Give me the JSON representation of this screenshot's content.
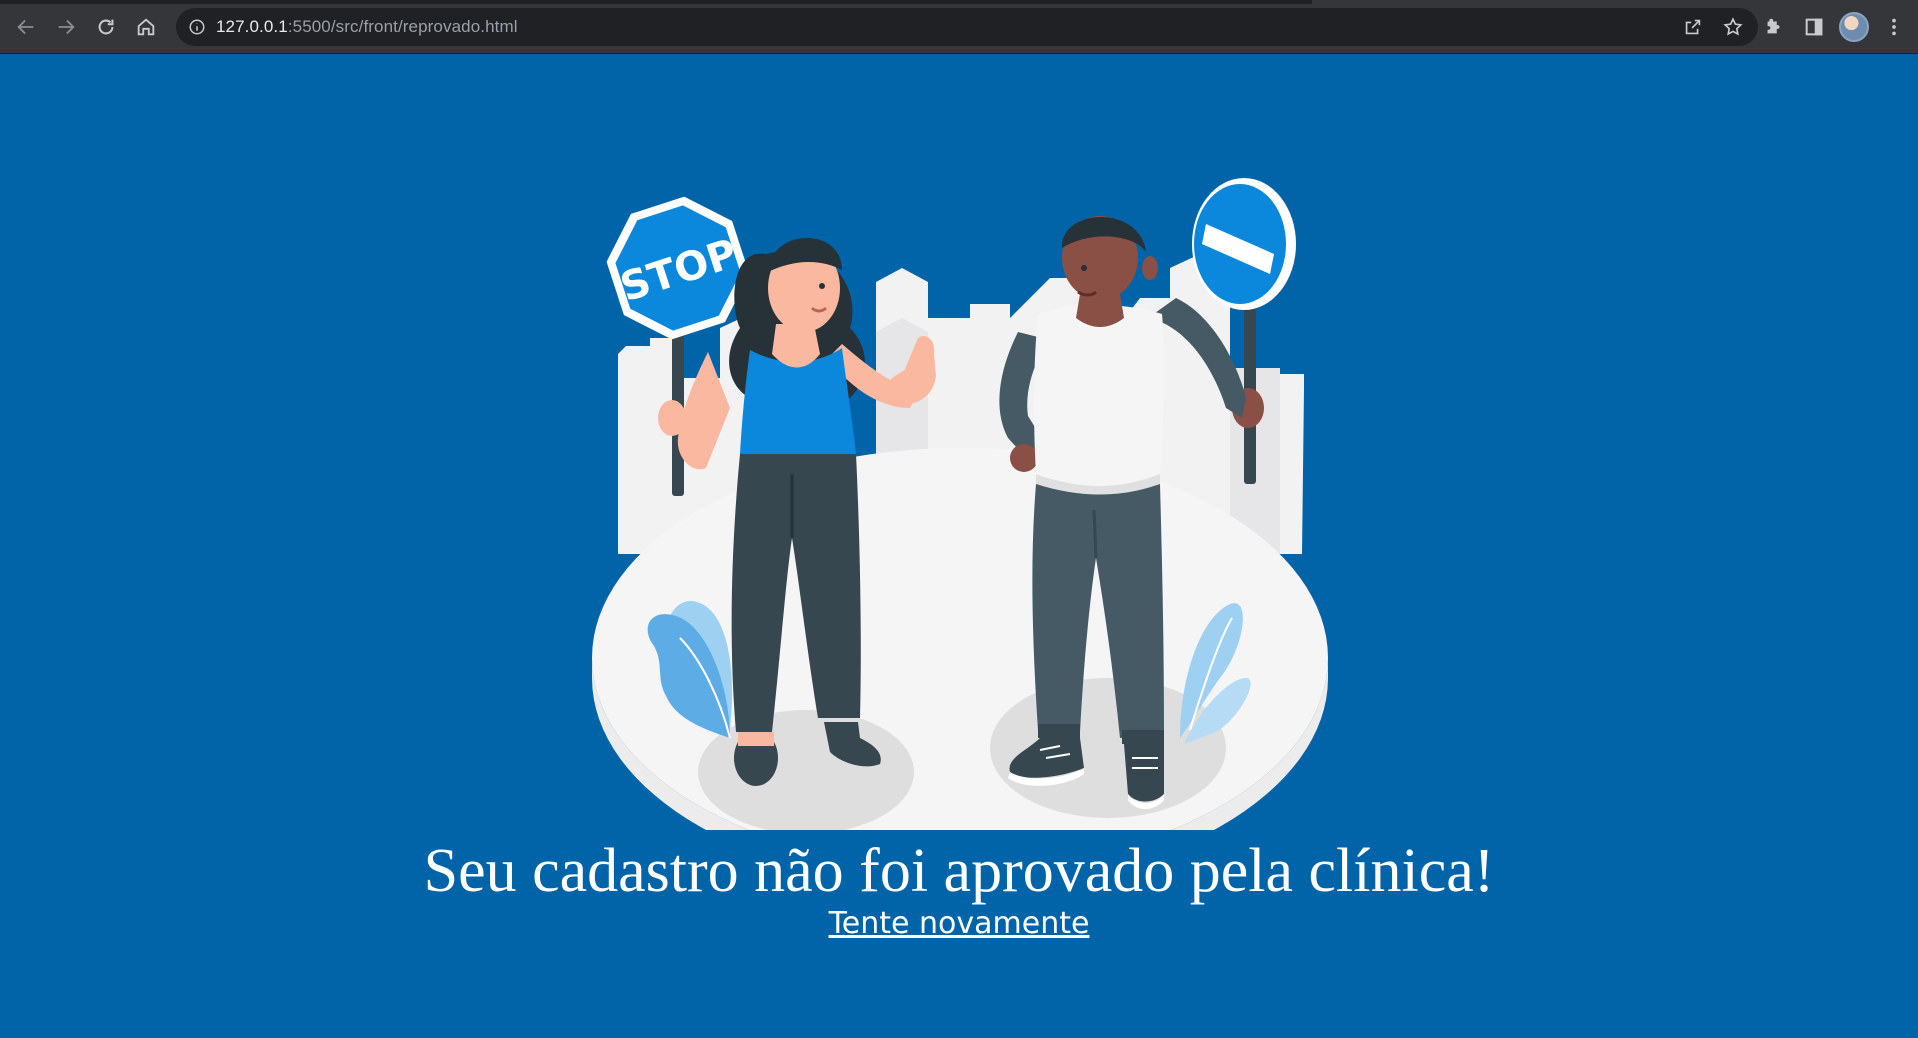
{
  "browser": {
    "url_host": "127.0.0.1",
    "url_rest": ":5500/src/front/reprovado.html"
  },
  "icons": {
    "back": "arrow-left-icon",
    "forward": "arrow-right-icon",
    "reload": "reload-icon",
    "home": "home-icon",
    "site_info": "info-icon",
    "share": "share-icon",
    "bookmark": "star-icon",
    "extensions": "puzzle-icon",
    "side_panel": "side-panel-icon",
    "profile": "avatar",
    "menu": "kebab-menu-icon"
  },
  "illustration": {
    "stop_sign_text": "STOP"
  },
  "page": {
    "message": "Seu cadastro não foi aprovado pela clínica!",
    "retry_link": "Tente novamente"
  },
  "colors": {
    "background": "#0264a8",
    "accent_blue": "#0b87dc",
    "text": "#ffffff"
  }
}
